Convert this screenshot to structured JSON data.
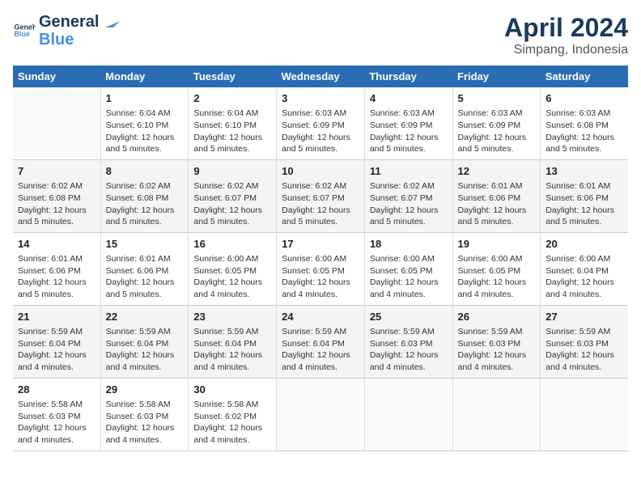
{
  "logo": {
    "line1": "General",
    "line2": "Blue"
  },
  "title": "April 2024",
  "subtitle": "Simpang, Indonesia",
  "days_of_week": [
    "Sunday",
    "Monday",
    "Tuesday",
    "Wednesday",
    "Thursday",
    "Friday",
    "Saturday"
  ],
  "weeks": [
    [
      {
        "day": "",
        "info": ""
      },
      {
        "day": "1",
        "info": "Sunrise: 6:04 AM\nSunset: 6:10 PM\nDaylight: 12 hours\nand 5 minutes."
      },
      {
        "day": "2",
        "info": "Sunrise: 6:04 AM\nSunset: 6:10 PM\nDaylight: 12 hours\nand 5 minutes."
      },
      {
        "day": "3",
        "info": "Sunrise: 6:03 AM\nSunset: 6:09 PM\nDaylight: 12 hours\nand 5 minutes."
      },
      {
        "day": "4",
        "info": "Sunrise: 6:03 AM\nSunset: 6:09 PM\nDaylight: 12 hours\nand 5 minutes."
      },
      {
        "day": "5",
        "info": "Sunrise: 6:03 AM\nSunset: 6:09 PM\nDaylight: 12 hours\nand 5 minutes."
      },
      {
        "day": "6",
        "info": "Sunrise: 6:03 AM\nSunset: 6:08 PM\nDaylight: 12 hours\nand 5 minutes."
      }
    ],
    [
      {
        "day": "7",
        "info": "Sunrise: 6:02 AM\nSunset: 6:08 PM\nDaylight: 12 hours\nand 5 minutes."
      },
      {
        "day": "8",
        "info": "Sunrise: 6:02 AM\nSunset: 6:08 PM\nDaylight: 12 hours\nand 5 minutes."
      },
      {
        "day": "9",
        "info": "Sunrise: 6:02 AM\nSunset: 6:07 PM\nDaylight: 12 hours\nand 5 minutes."
      },
      {
        "day": "10",
        "info": "Sunrise: 6:02 AM\nSunset: 6:07 PM\nDaylight: 12 hours\nand 5 minutes."
      },
      {
        "day": "11",
        "info": "Sunrise: 6:02 AM\nSunset: 6:07 PM\nDaylight: 12 hours\nand 5 minutes."
      },
      {
        "day": "12",
        "info": "Sunrise: 6:01 AM\nSunset: 6:06 PM\nDaylight: 12 hours\nand 5 minutes."
      },
      {
        "day": "13",
        "info": "Sunrise: 6:01 AM\nSunset: 6:06 PM\nDaylight: 12 hours\nand 5 minutes."
      }
    ],
    [
      {
        "day": "14",
        "info": "Sunrise: 6:01 AM\nSunset: 6:06 PM\nDaylight: 12 hours\nand 5 minutes."
      },
      {
        "day": "15",
        "info": "Sunrise: 6:01 AM\nSunset: 6:06 PM\nDaylight: 12 hours\nand 5 minutes."
      },
      {
        "day": "16",
        "info": "Sunrise: 6:00 AM\nSunset: 6:05 PM\nDaylight: 12 hours\nand 4 minutes."
      },
      {
        "day": "17",
        "info": "Sunrise: 6:00 AM\nSunset: 6:05 PM\nDaylight: 12 hours\nand 4 minutes."
      },
      {
        "day": "18",
        "info": "Sunrise: 6:00 AM\nSunset: 6:05 PM\nDaylight: 12 hours\nand 4 minutes."
      },
      {
        "day": "19",
        "info": "Sunrise: 6:00 AM\nSunset: 6:05 PM\nDaylight: 12 hours\nand 4 minutes."
      },
      {
        "day": "20",
        "info": "Sunrise: 6:00 AM\nSunset: 6:04 PM\nDaylight: 12 hours\nand 4 minutes."
      }
    ],
    [
      {
        "day": "21",
        "info": "Sunrise: 5:59 AM\nSunset: 6:04 PM\nDaylight: 12 hours\nand 4 minutes."
      },
      {
        "day": "22",
        "info": "Sunrise: 5:59 AM\nSunset: 6:04 PM\nDaylight: 12 hours\nand 4 minutes."
      },
      {
        "day": "23",
        "info": "Sunrise: 5:59 AM\nSunset: 6:04 PM\nDaylight: 12 hours\nand 4 minutes."
      },
      {
        "day": "24",
        "info": "Sunrise: 5:59 AM\nSunset: 6:04 PM\nDaylight: 12 hours\nand 4 minutes."
      },
      {
        "day": "25",
        "info": "Sunrise: 5:59 AM\nSunset: 6:03 PM\nDaylight: 12 hours\nand 4 minutes."
      },
      {
        "day": "26",
        "info": "Sunrise: 5:59 AM\nSunset: 6:03 PM\nDaylight: 12 hours\nand 4 minutes."
      },
      {
        "day": "27",
        "info": "Sunrise: 5:59 AM\nSunset: 6:03 PM\nDaylight: 12 hours\nand 4 minutes."
      }
    ],
    [
      {
        "day": "28",
        "info": "Sunrise: 5:58 AM\nSunset: 6:03 PM\nDaylight: 12 hours\nand 4 minutes."
      },
      {
        "day": "29",
        "info": "Sunrise: 5:58 AM\nSunset: 6:03 PM\nDaylight: 12 hours\nand 4 minutes."
      },
      {
        "day": "30",
        "info": "Sunrise: 5:58 AM\nSunset: 6:02 PM\nDaylight: 12 hours\nand 4 minutes."
      },
      {
        "day": "",
        "info": ""
      },
      {
        "day": "",
        "info": ""
      },
      {
        "day": "",
        "info": ""
      },
      {
        "day": "",
        "info": ""
      }
    ]
  ]
}
